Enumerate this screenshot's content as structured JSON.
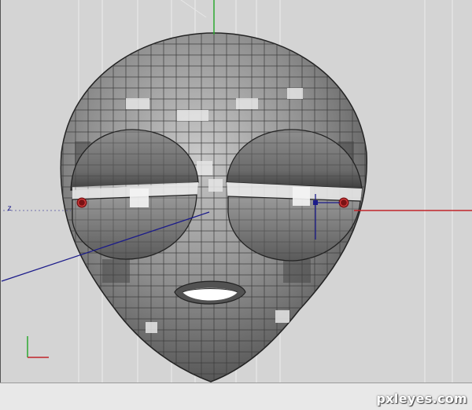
{
  "viewport": {
    "axis_label_z": "z"
  },
  "colors": {
    "background": "#d4d4d4",
    "mesh_dark": "#5e5e5e",
    "mesh_light": "#cfcfcf",
    "wire": "#2f2f2f",
    "x_axis": "#c0242a",
    "y_axis": "#2ca830",
    "z_axis": "#1b1b8a",
    "pupil": "#c0242a"
  },
  "watermark": {
    "text": "pxleyes.com"
  }
}
